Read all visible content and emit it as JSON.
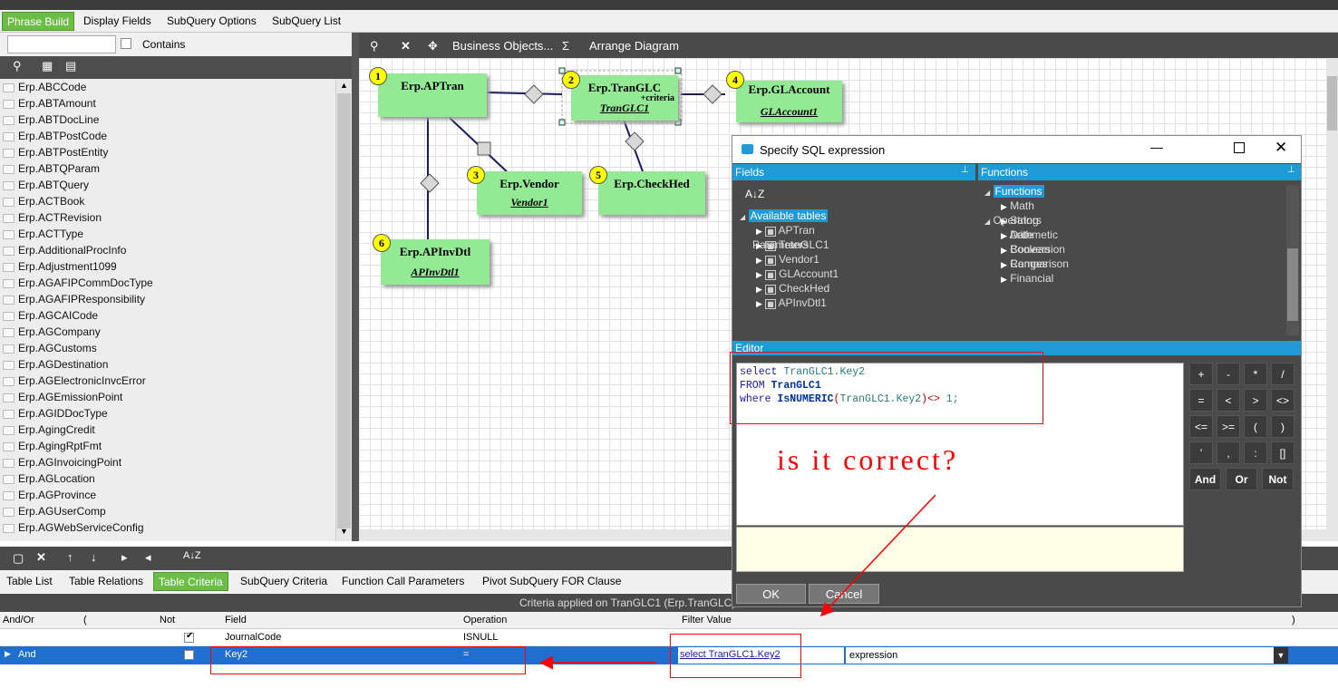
{
  "tabs": [
    "Phrase Build",
    "Display Fields",
    "SubQuery Options",
    "SubQuery List"
  ],
  "filter": {
    "contains_label": "Contains"
  },
  "tables_list": [
    "Erp.ABCCode",
    "Erp.ABTAmount",
    "Erp.ABTDocLine",
    "Erp.ABTPostCode",
    "Erp.ABTPostEntity",
    "Erp.ABTQParam",
    "Erp.ABTQuery",
    "Erp.ACTBook",
    "Erp.ACTRevision",
    "Erp.ACTType",
    "Erp.AdditionalProcInfo",
    "Erp.Adjustment1099",
    "Erp.AGAFIPCommDocType",
    "Erp.AGAFIPResponsibility",
    "Erp.AGCAICode",
    "Erp.AGCompany",
    "Erp.AGCustoms",
    "Erp.AGDestination",
    "Erp.AGElectronicInvcError",
    "Erp.AGEmissionPoint",
    "Erp.AGIDDocType",
    "Erp.AgingCredit",
    "Erp.AgingRptFmt",
    "Erp.AGInvoicingPoint",
    "Erp.AGLocation",
    "Erp.AGProvince",
    "Erp.AGUserComp",
    "Erp.AGWebServiceConfig"
  ],
  "diagram_toolbar": {
    "business_objects": "Business Objects...",
    "sigma": "Σ",
    "arrange": "Arrange Diagram"
  },
  "entities": [
    {
      "num": "1",
      "name": "Erp.APTran",
      "alias": ""
    },
    {
      "num": "2",
      "name": "Erp.TranGLC",
      "alias": "TranGLC1",
      "note": "+criteria"
    },
    {
      "num": "3",
      "name": "Erp.Vendor",
      "alias": "Vendor1"
    },
    {
      "num": "4",
      "name": "Erp.GLAccount",
      "alias": "GLAccount1"
    },
    {
      "num": "5",
      "name": "Erp.CheckHed",
      "alias": ""
    },
    {
      "num": "6",
      "name": "Erp.APInvDtl",
      "alias": "APInvDtl1"
    }
  ],
  "dialog": {
    "title": "Specify SQL expression",
    "fields_header": "Fields",
    "functions_header": "Functions",
    "sort_icon": "A↓Z",
    "available_tables": "Available tables",
    "tables": [
      "APTran",
      "TranGLC1",
      "Vendor1",
      "GLAccount1",
      "CheckHed",
      "APInvDtl1"
    ],
    "parameters": "Parameters",
    "functions_root": "Functions",
    "function_items": [
      "Math",
      "String",
      "Date",
      "Conversion",
      "Ranges",
      "Financial"
    ],
    "operators_root": "Operators",
    "operator_items": [
      "Arithmetic",
      "Boolean",
      "Comparison"
    ],
    "editor_header": "Editor",
    "sql_lines": [
      [
        "select",
        "TranGLC1.Key2",
        "",
        "",
        ""
      ],
      [
        "FROM",
        "TranGLC1",
        "",
        "",
        ""
      ]
    ],
    "sql": {
      "l1_kw": "select",
      "l1_ref": "TranGLC1.Key2",
      "l2_kw": "FROM",
      "l2_tbl": "TranGLC1",
      "l3_kw": "where",
      "l3_fn": "IsNUMERIC",
      "l3_paren1": "(",
      "l3_ref": "TranGLC1.Key2",
      "l3_paren2": ")",
      "l3_op": "<>",
      "l3_val": "1;"
    },
    "keys": [
      "+",
      "-",
      "*",
      "/",
      "=",
      "<",
      ">",
      "<>",
      "<=",
      ">=",
      "(",
      ")",
      "'",
      ",",
      ":",
      "[]"
    ],
    "logic_keys": [
      "And",
      "Or",
      "Not"
    ],
    "ok": "OK",
    "cancel": "Cancel"
  },
  "annotation": "is it correct?",
  "bottom_tabs": [
    "Table List",
    "Table Relations",
    "Table Criteria",
    "SubQuery Criteria",
    "Function Call Parameters",
    "Pivot SubQuery FOR Clause"
  ],
  "criteria_title": "Criteria applied on TranGLC1 (Erp.TranGLC)",
  "grid": {
    "headers": [
      "And/Or",
      "(",
      "Not",
      "Field",
      "Operation",
      "Filter Value",
      ")"
    ],
    "rows": [
      {
        "andor": "",
        "not": true,
        "field": "JournalCode",
        "op": "ISNULL",
        "value": "",
        "type": ""
      },
      {
        "andor": "And",
        "not": false,
        "field": "Key2",
        "op": "=",
        "value": "select TranGLC1.Key2",
        "type": "expression"
      }
    ]
  },
  "colors": {
    "accent": "#6cbd45",
    "panel": "#4a4a4a",
    "header": "#1e9ad6",
    "entity": "#94ea94",
    "badge": "#ffff00",
    "selection": "#1f6fd0",
    "annotation": "#ff0000"
  }
}
